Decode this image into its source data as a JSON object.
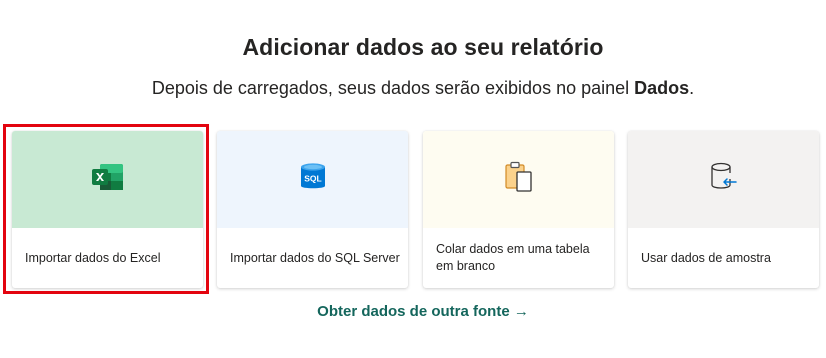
{
  "header": {
    "title": "Adicionar dados ao seu relatório",
    "subtitle_prefix": "Depois de carregados, seus dados serão exibidos no painel ",
    "subtitle_bold": "Dados",
    "subtitle_suffix": "."
  },
  "cards": [
    {
      "label": "Importar dados do Excel",
      "icon": "excel-icon",
      "selected": true,
      "thumb_color": "#c8e9d3"
    },
    {
      "label": "Importar dados do SQL Server",
      "icon": "sql-server-icon",
      "icon_text": "SQL",
      "thumb_color": "#eef5fd"
    },
    {
      "label": "Colar dados em uma tabela em branco",
      "icon": "paste-icon",
      "thumb_color": "#fefcf1"
    },
    {
      "label": "Usar dados de amostra",
      "icon": "sample-data-icon",
      "thumb_color": "#f3f2f1"
    }
  ],
  "footer": {
    "other_source_link": "Obter dados de outra fonte",
    "arrow": "→"
  },
  "colors": {
    "link": "#14665c",
    "highlight": "#e3040f"
  }
}
